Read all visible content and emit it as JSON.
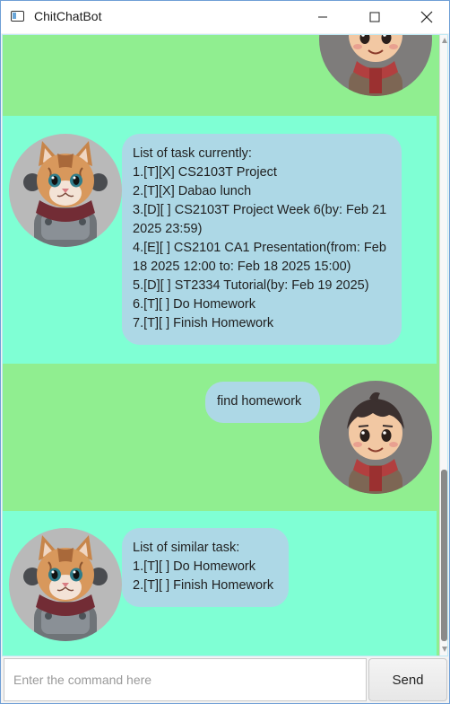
{
  "window": {
    "title": "ChitChatBot",
    "controls": [
      "minimize",
      "maximize",
      "close"
    ]
  },
  "conversation": {
    "messages": [
      {
        "speaker": "user",
        "avatar_icon": "boy-avatar",
        "lines": []
      },
      {
        "speaker": "bot",
        "avatar_icon": "cat-robot-avatar",
        "lines": [
          "List of task currently:",
          "1.[T][X] CS2103T Project",
          "2.[T][X] Dabao lunch",
          "3.[D][ ] CS2103T Project Week 6(by: Feb 21",
          "2025 23:59)",
          "4.[E][ ] CS2101 CA1 Presentation(from: Feb",
          "18 2025 12:00 to: Feb 18 2025 15:00)",
          "5.[D][ ] ST2334 Tutorial(by: Feb 19 2025)",
          "6.[T][ ] Do Homework",
          "7.[T][ ] Finish Homework"
        ]
      },
      {
        "speaker": "user",
        "avatar_icon": "boy-avatar",
        "lines": [
          "find homework"
        ]
      },
      {
        "speaker": "bot",
        "avatar_icon": "cat-robot-avatar",
        "lines": [
          "List of similar task:",
          "1.[T][ ] Do Homework",
          "2.[T][ ] Finish Homework"
        ]
      }
    ]
  },
  "input": {
    "placeholder": "Enter the command here",
    "value": ""
  },
  "send_button": {
    "label": "Send"
  },
  "colors": {
    "user_background": "#90ee90",
    "bot_background": "#7fffd4",
    "bubble": "#add8e6"
  }
}
